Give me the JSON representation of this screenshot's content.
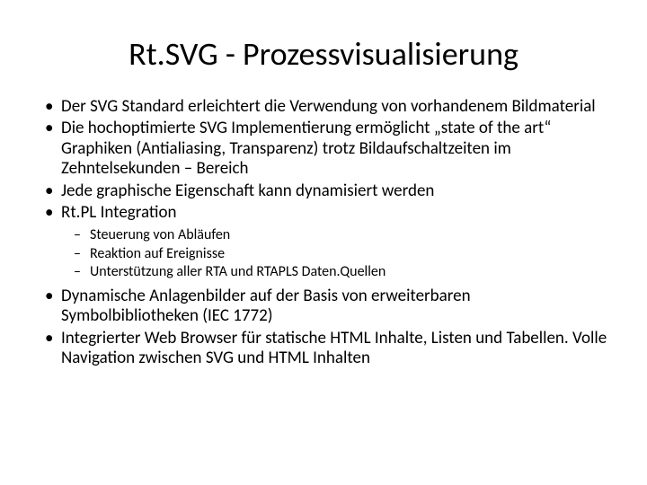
{
  "title": "Rt.SVG - Prozessvisualisierung",
  "bullets": [
    {
      "text": "Der SVG Standard erleichtert die Verwendung von vorhandenem Bildmaterial"
    },
    {
      "text": "Die hochoptimierte SVG Implementierung ermöglicht „state of the art“ Graphiken (Antialiasing, Transparenz) trotz Bildaufschaltzeiten im Zehntelsekunden – Bereich"
    },
    {
      "text": "Jede graphische Eigenschaft kann dynamisiert werden"
    },
    {
      "text": "Rt.PL Integration",
      "sub": [
        "Steuerung von Abläufen",
        "Reaktion auf Ereignisse",
        "Unterstützung aller RTA und RTAPLS Daten.Quellen"
      ]
    },
    {
      "text": "Dynamische Anlagenbilder auf der Basis von erweiterbaren Symbolbibliotheken (IEC 1772)"
    },
    {
      "text": "Integrierter Web Browser für statische HTML Inhalte, Listen und Tabellen. Volle Navigation zwischen SVG und HTML Inhalten"
    }
  ]
}
